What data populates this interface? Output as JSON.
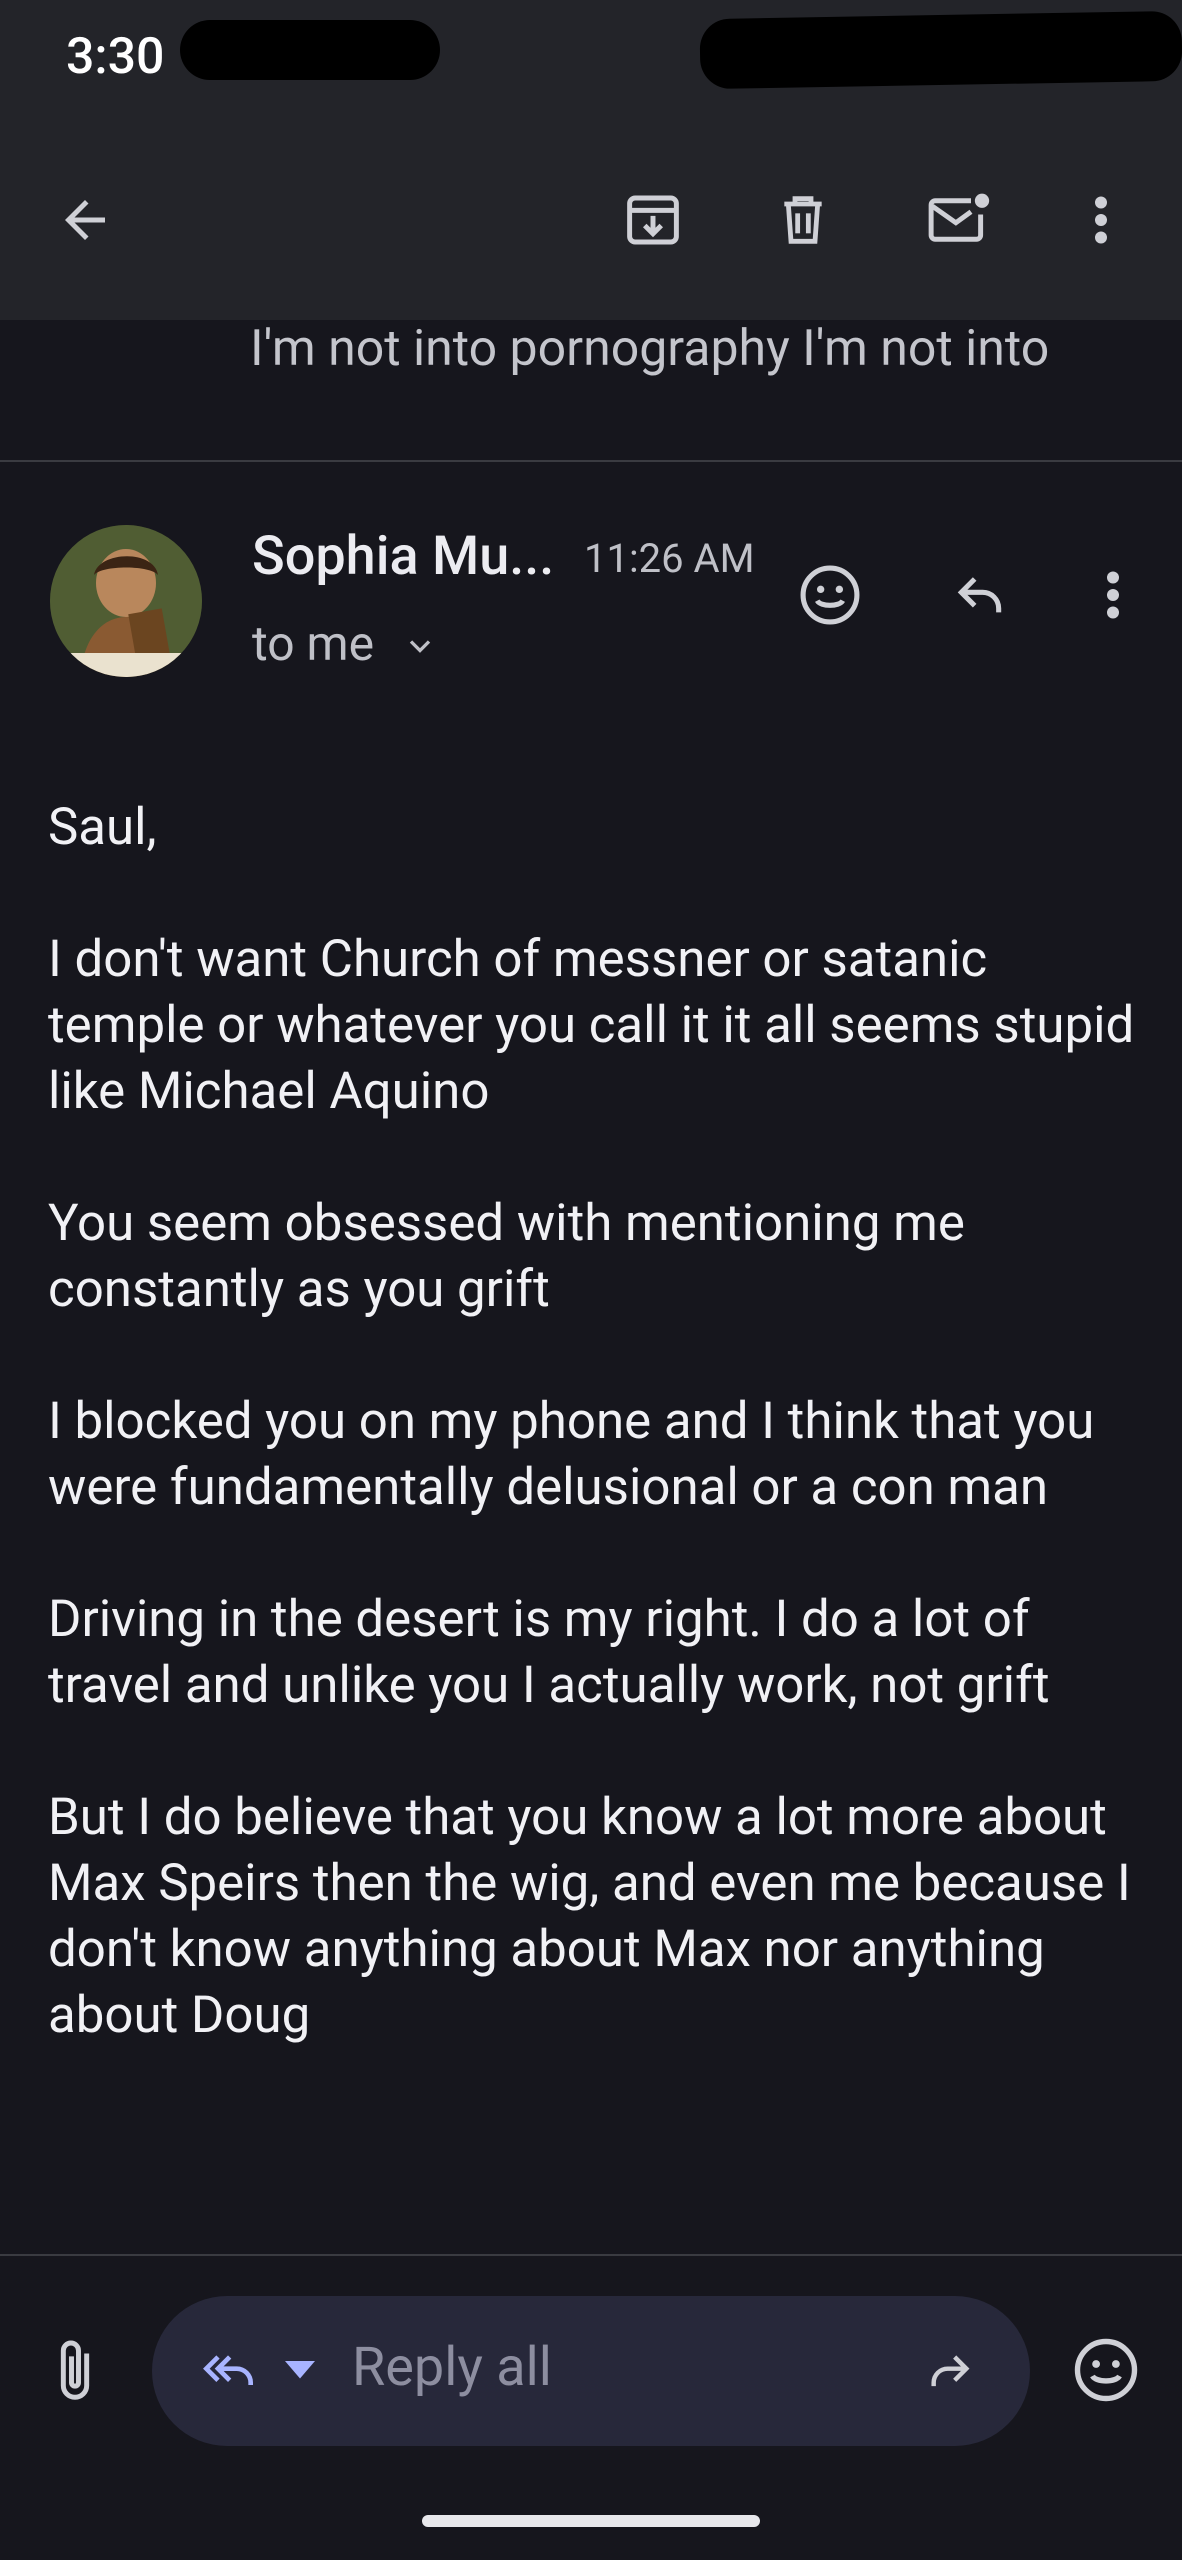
{
  "status_bar": {
    "time": "3:30"
  },
  "toolbar": {
    "back_icon": "arrow-back-icon",
    "archive_icon": "archive-icon",
    "delete_icon": "trash-icon",
    "mark_unread_icon": "mark-unread-icon",
    "more_icon": "more-vert-icon"
  },
  "previous_message": {
    "snippet": "I'm not into pornography I'm not into"
  },
  "message": {
    "sender_name": "Sophia Mu...",
    "time": "11:26 AM",
    "recipient": "to me",
    "body": [
      "Saul,",
      "I don't want Church of messner or satanic temple or whatever you call it it all seems stupid like Michael Aquino",
      "You seem obsessed with mentioning me constantly as you grift",
      "I blocked you on my phone and I think that you were fundamentally delusional or a con man",
      "Driving in the desert is my right. I do a lot of travel and unlike you I actually work, not grift",
      "But I do believe that you know a lot more about Max Speirs then the wig, and even me because I don't know anything about Max nor anything about Doug"
    ]
  },
  "reply_bar": {
    "placeholder": "Reply all",
    "attach_icon": "paperclip-icon",
    "reply_all_icon": "reply-all-icon",
    "forward_icon": "forward-icon",
    "emoji_icon": "emoji-icon"
  },
  "colors": {
    "background": "#16161d",
    "appbar": "#232429",
    "reply_pill": "#27283a",
    "accent": "#a8b4ff"
  }
}
